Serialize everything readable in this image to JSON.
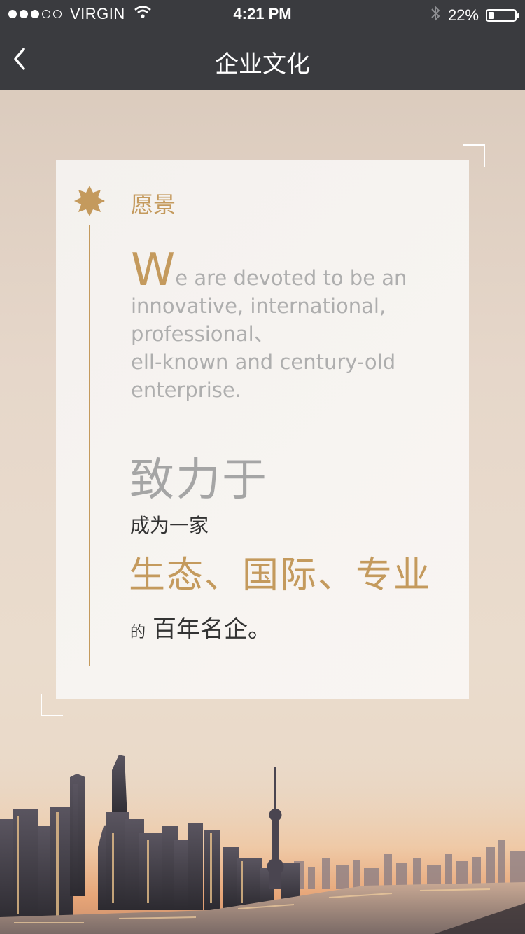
{
  "status_bar": {
    "carrier": "VIRGIN",
    "time": "4:21 PM",
    "battery": "22%",
    "battery_level": 0.22,
    "signal_bars_filled": 3,
    "signal_bars_total": 5,
    "icons": [
      "wifi-icon",
      "bluetooth-icon",
      "battery-icon"
    ]
  },
  "nav": {
    "title": "企业文化",
    "back_icon": "chevron-left-icon"
  },
  "card": {
    "heading": "愿景",
    "en_first_letter": "W",
    "en_rest": "e are devoted to be an\ninnovative, international,\nprofessional、\nell-known and century-old\nenterprise.",
    "cn_line1": "致力于",
    "cn_line2": "成为一家",
    "cn_line3": "生态、国际、专业",
    "cn_line4_small": "的",
    "cn_line4_large": "百年名企。"
  },
  "colors": {
    "accent": "#c49a5d",
    "bar": "#3a3b3f"
  }
}
